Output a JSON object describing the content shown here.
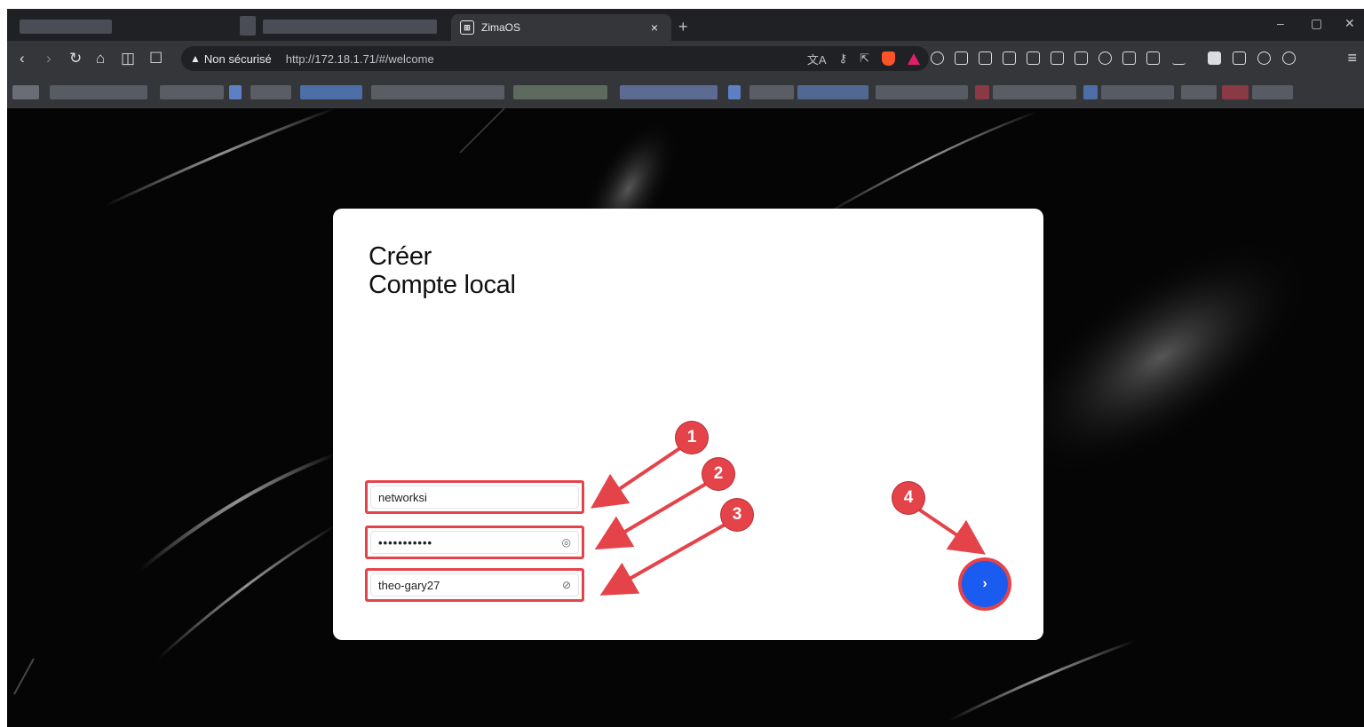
{
  "browser": {
    "tab_title": "ZimaOS",
    "tab_close": "×",
    "new_tab": "+",
    "security_label": "Non sécurisé",
    "url": "http://172.18.1.71/#/welcome",
    "window_min": "–",
    "window_max": "▢",
    "window_close": "✕"
  },
  "card": {
    "heading_line1": "Créer",
    "heading_line2": "Compte local",
    "username_value": "networksi",
    "password_value": "•••••••••••",
    "confirm_value": "theo-gary27",
    "next_symbol": "›"
  },
  "annotations": {
    "badge_1": "1",
    "badge_2": "2",
    "badge_3": "3",
    "badge_4": "4",
    "color": "#e5434a"
  },
  "colors": {
    "accent_button": "#1a5bf0",
    "annotation_red": "#e5434a",
    "page_background": "#050505"
  }
}
